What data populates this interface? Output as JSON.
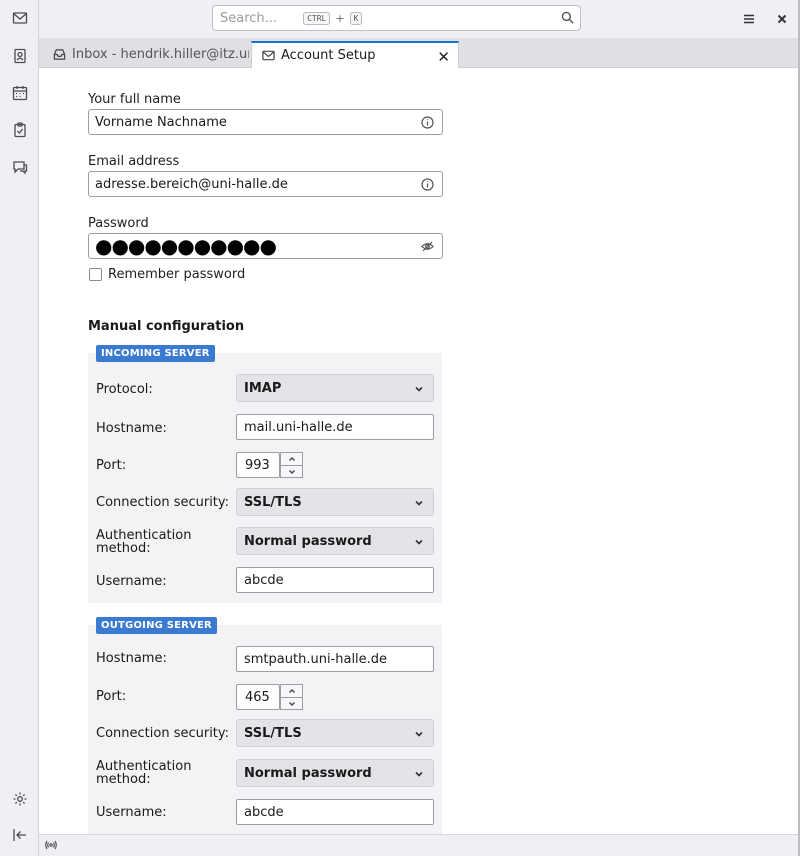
{
  "toolbar": {
    "search_placeholder": "Search...",
    "shortcut_key1": "CTRL",
    "shortcut_plus": "+",
    "shortcut_key2": "K"
  },
  "spaces": {
    "items": [
      "mail-icon",
      "address-book-icon",
      "calendar-icon",
      "tasks-icon",
      "chat-icon",
      "settings-icon",
      "collapse-icon"
    ]
  },
  "tabs": [
    {
      "label": "Inbox - hendrik.hiller@itz.uni-h"
    },
    {
      "label": "Account Setup"
    }
  ],
  "form": {
    "fullname_label": "Your full name",
    "fullname_value": "Vorname Nachname",
    "email_label": "Email address",
    "email_value": "adresse.bereich@uni-halle.de",
    "password_label": "Password",
    "password_value": "●●●●●●●●●●●",
    "remember_label": "Remember password",
    "remember_checked": false
  },
  "manual": {
    "title": "Manual configuration",
    "incoming": {
      "badge": "INCOMING SERVER",
      "protocol_label": "Protocol:",
      "protocol_value": "IMAP",
      "hostname_label": "Hostname:",
      "hostname_value": "mail.uni-halle.de",
      "port_label": "Port:",
      "port_value": "993",
      "security_label": "Connection security:",
      "security_value": "SSL/TLS",
      "auth_label_1": "Authentication",
      "auth_label_2": "method:",
      "auth_value": "Normal password",
      "username_label": "Username:",
      "username_value": "abcde"
    },
    "outgoing": {
      "badge": "OUTGOING SERVER",
      "hostname_label": "Hostname:",
      "hostname_value": "smtpauth.uni-halle.de",
      "port_label": "Port:",
      "port_value": "465",
      "security_label": "Connection security:",
      "security_value": "SSL/TLS",
      "auth_label_1": "Authentication",
      "auth_label_2": "method:",
      "auth_value": "Normal password",
      "username_label": "Username:",
      "username_value": "abcde"
    }
  },
  "colors": {
    "accent": "#1373d9",
    "badge": "#3a7bd1"
  }
}
